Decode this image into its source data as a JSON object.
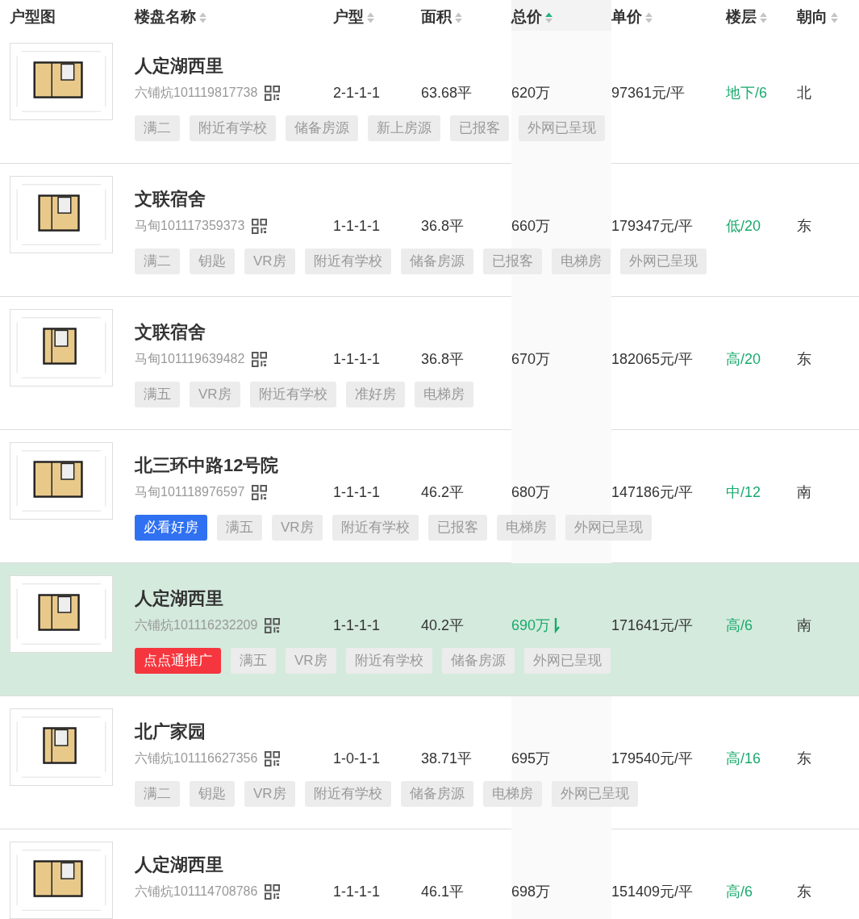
{
  "columns": [
    {
      "label": "户型图"
    },
    {
      "label": "楼盘名称",
      "sorted": false
    },
    {
      "label": "户型",
      "sorted": false
    },
    {
      "label": "面积",
      "sorted": false
    },
    {
      "label": "总价",
      "sorted": true
    },
    {
      "label": "单价",
      "sorted": false
    },
    {
      "label": "楼层",
      "sorted": false
    },
    {
      "label": "朝向",
      "sorted": false
    }
  ],
  "rows": [
    {
      "selected": false,
      "name": "人定湖西里",
      "code": "六铺炕101119817738",
      "layout": "2-1-1-1",
      "area": "63.68平",
      "price": "620万",
      "price_dropped": false,
      "unit_price": "97361元/平",
      "floor": "地下/6",
      "orientation": "北",
      "tags": [
        {
          "kind": "plain",
          "text": "满二"
        },
        {
          "kind": "plain",
          "text": "附近有学校"
        },
        {
          "kind": "plain",
          "text": "储备房源"
        },
        {
          "kind": "plain",
          "text": "新上房源"
        },
        {
          "kind": "plain",
          "text": "已报客"
        },
        {
          "kind": "plain",
          "text": "外网已呈现"
        }
      ]
    },
    {
      "selected": false,
      "name": "文联宿舍",
      "code": "马甸101117359373",
      "layout": "1-1-1-1",
      "area": "36.8平",
      "price": "660万",
      "price_dropped": false,
      "unit_price": "179347元/平",
      "floor": "低/20",
      "orientation": "东",
      "tags": [
        {
          "kind": "plain",
          "text": "满二"
        },
        {
          "kind": "plain",
          "text": "钥匙"
        },
        {
          "kind": "plain",
          "text": "VR房"
        },
        {
          "kind": "plain",
          "text": "附近有学校"
        },
        {
          "kind": "plain",
          "text": "储备房源"
        },
        {
          "kind": "plain",
          "text": "已报客"
        },
        {
          "kind": "plain",
          "text": "电梯房"
        },
        {
          "kind": "plain",
          "text": "外网已呈现"
        }
      ]
    },
    {
      "selected": false,
      "name": "文联宿舍",
      "code": "马甸101119639482",
      "layout": "1-1-1-1",
      "area": "36.8平",
      "price": "670万",
      "price_dropped": false,
      "unit_price": "182065元/平",
      "floor": "高/20",
      "orientation": "东",
      "tags": [
        {
          "kind": "plain",
          "text": "满五"
        },
        {
          "kind": "plain",
          "text": "VR房"
        },
        {
          "kind": "plain",
          "text": "附近有学校"
        },
        {
          "kind": "plain",
          "text": "准好房"
        },
        {
          "kind": "plain",
          "text": "电梯房"
        }
      ]
    },
    {
      "selected": false,
      "name": "北三环中路12号院",
      "code": "马甸101118976597",
      "layout": "1-1-1-1",
      "area": "46.2平",
      "price": "680万",
      "price_dropped": false,
      "unit_price": "147186元/平",
      "floor": "中/12",
      "orientation": "南",
      "tags": [
        {
          "kind": "featured",
          "text": "必看好房"
        },
        {
          "kind": "plain",
          "text": "满五"
        },
        {
          "kind": "plain",
          "text": "VR房"
        },
        {
          "kind": "plain",
          "text": "附近有学校"
        },
        {
          "kind": "plain",
          "text": "已报客"
        },
        {
          "kind": "plain",
          "text": "电梯房"
        },
        {
          "kind": "plain",
          "text": "外网已呈现"
        }
      ]
    },
    {
      "selected": true,
      "name": "人定湖西里",
      "code": "六铺炕101116232209",
      "layout": "1-1-1-1",
      "area": "40.2平",
      "price": "690万",
      "price_dropped": true,
      "unit_price": "171641元/平",
      "floor": "高/6",
      "orientation": "南",
      "tags": [
        {
          "kind": "promoted",
          "text": "点点通推广"
        },
        {
          "kind": "plain",
          "text": "满五"
        },
        {
          "kind": "plain",
          "text": "VR房"
        },
        {
          "kind": "plain",
          "text": "附近有学校"
        },
        {
          "kind": "plain",
          "text": "储备房源"
        },
        {
          "kind": "plain",
          "text": "外网已呈现"
        }
      ]
    },
    {
      "selected": false,
      "name": "北广家园",
      "code": "六铺炕101116627356",
      "layout": "1-0-1-1",
      "area": "38.71平",
      "price": "695万",
      "price_dropped": false,
      "unit_price": "179540元/平",
      "floor": "高/16",
      "orientation": "东",
      "tags": [
        {
          "kind": "plain",
          "text": "满二"
        },
        {
          "kind": "plain",
          "text": "钥匙"
        },
        {
          "kind": "plain",
          "text": "VR房"
        },
        {
          "kind": "plain",
          "text": "附近有学校"
        },
        {
          "kind": "plain",
          "text": "储备房源"
        },
        {
          "kind": "plain",
          "text": "电梯房"
        },
        {
          "kind": "plain",
          "text": "外网已呈现"
        }
      ]
    },
    {
      "selected": false,
      "name": "人定湖西里",
      "code": "六铺炕101114708786",
      "layout": "1-1-1-1",
      "area": "46.1平",
      "price": "698万",
      "price_dropped": false,
      "unit_price": "151409元/平",
      "floor": "高/6",
      "orientation": "东"
    }
  ]
}
